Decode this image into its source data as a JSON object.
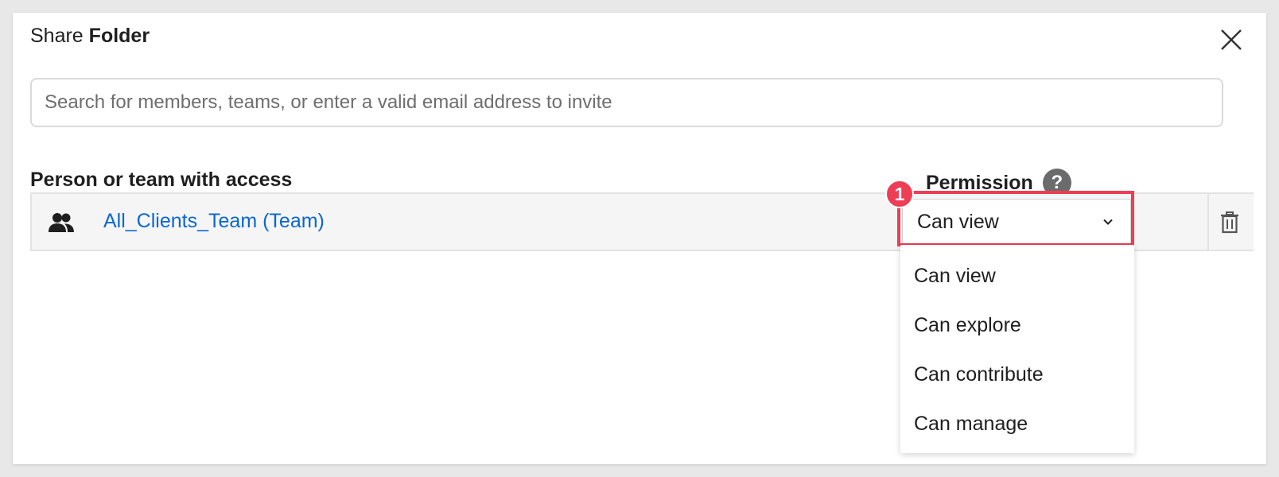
{
  "dialog": {
    "title_prefix": "Share",
    "title_bold": "Folder",
    "close_icon": "close-icon"
  },
  "search": {
    "placeholder": "Search for members, teams, or enter a valid email address to invite",
    "value": ""
  },
  "columns": {
    "person": "Person or team with access",
    "permission": "Permission",
    "help": "?"
  },
  "access_rows": [
    {
      "icon": "team-icon",
      "name": "All_Clients_Team (Team)",
      "permission": "Can view",
      "delete_icon": "trash-icon"
    }
  ],
  "permission_menu": {
    "options": [
      "Can view",
      "Can explore",
      "Can contribute",
      "Can manage"
    ]
  },
  "annotation": {
    "step": "1",
    "color": "#ee3d55"
  },
  "colors": {
    "link": "#0b66d0",
    "accent": "#ee3d55",
    "help_bg": "#6b6b6b"
  }
}
